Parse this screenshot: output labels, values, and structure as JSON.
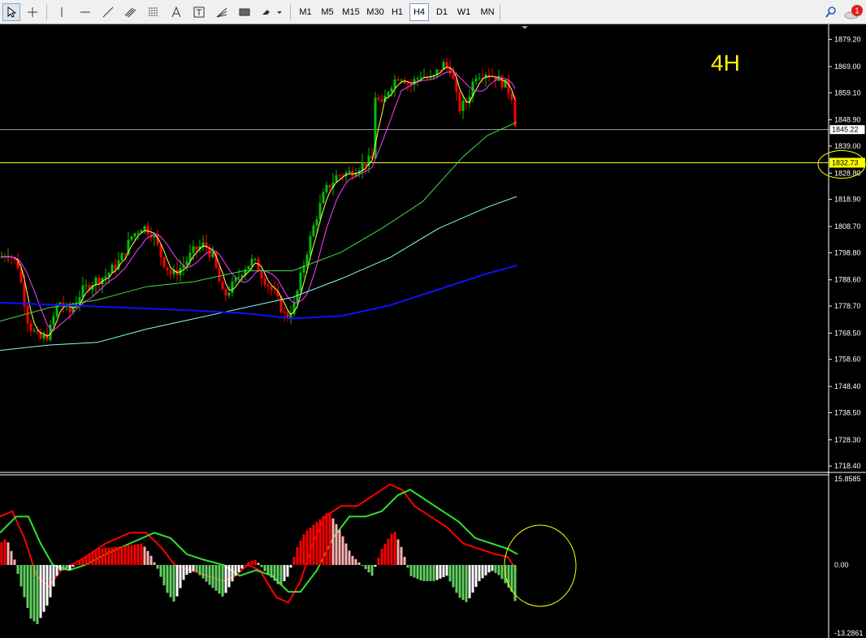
{
  "toolbar": {
    "tools": [
      {
        "name": "cursor-icon"
      },
      {
        "name": "crosshair-icon"
      },
      {
        "name": "vertical-line-icon"
      },
      {
        "name": "horizontal-line-icon"
      },
      {
        "name": "trend-line-icon"
      },
      {
        "name": "equidistant-channel-icon"
      },
      {
        "name": "fibonacci-retracement-icon"
      },
      {
        "name": "text-icon"
      },
      {
        "name": "text-label-icon"
      },
      {
        "name": "fibonacci-fan-icon"
      },
      {
        "name": "rectangle-icon"
      },
      {
        "name": "arrows-icon"
      }
    ],
    "timeframes": [
      "M1",
      "M5",
      "M15",
      "M30",
      "H1",
      "H4",
      "D1",
      "W1",
      "MN"
    ],
    "active_timeframe": "H4",
    "notification_count": "1"
  },
  "chart": {
    "timeframe_label": "4H",
    "price_ticks": [
      "1879.20",
      "1869.00",
      "1859.10",
      "1848.90",
      "1839.00",
      "1828.80",
      "1818.90",
      "1808.70",
      "1798.80",
      "1788.60",
      "1778.70",
      "1768.50",
      "1758.60",
      "1748.40",
      "1738.50",
      "1728.30",
      "1718.40"
    ],
    "current_price": "1845.22",
    "marked_price": "1832.73",
    "osc_ticks": {
      "top": "15.8585",
      "zero": "0.00",
      "bottom": "-13.2861"
    },
    "colors": {
      "up": "#00c000",
      "down": "#ff0000",
      "ma_yellow": "#ffff66",
      "ma_magenta": "#ff40ff",
      "ma_green": "#40e040",
      "ma_cyan": "#80ffff",
      "ma_blue": "#1010ff",
      "macd_red": "#ff0000",
      "signal_green": "#30e030"
    }
  }
}
